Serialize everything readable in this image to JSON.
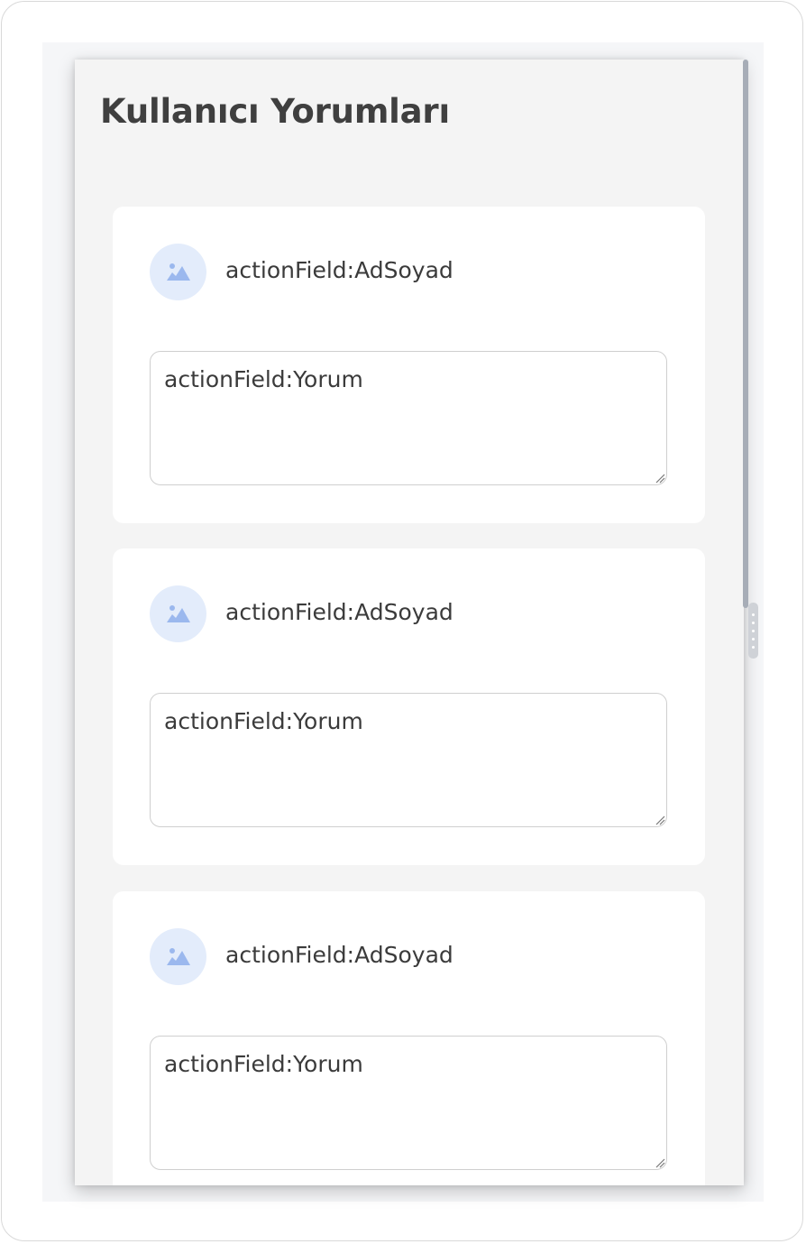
{
  "page": {
    "title": "Kullanıcı Yorumları"
  },
  "comments": [
    {
      "name": "actionField:AdSoyad",
      "text": "actionField:Yorum",
      "avatar_icon": "image-placeholder-icon"
    },
    {
      "name": "actionField:AdSoyad",
      "text": "actionField:Yorum",
      "avatar_icon": "image-placeholder-icon"
    },
    {
      "name": "actionField:AdSoyad",
      "text": "actionField:Yorum",
      "avatar_icon": "image-placeholder-icon"
    }
  ],
  "colors": {
    "panel_bg": "#f4f4f4",
    "card_bg": "#ffffff",
    "avatar_bg": "#e3ecfb",
    "avatar_icon": "#9bb8ee",
    "text": "#3b3b3b"
  }
}
